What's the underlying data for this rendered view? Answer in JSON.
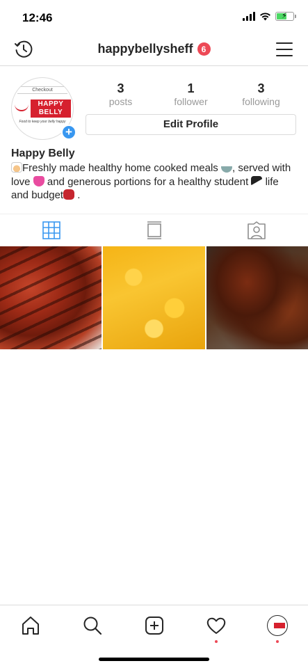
{
  "status_bar": {
    "time": "12:46"
  },
  "top_nav": {
    "username": "happybellysheff",
    "notification_count": "6"
  },
  "profile": {
    "avatar": {
      "checkout_text": "Checkout",
      "logo_text": "HAPPY BELLY",
      "tagline": "Food to keep your belly happy"
    },
    "stats": [
      {
        "count": "3",
        "label": "posts"
      },
      {
        "count": "1",
        "label": "follower"
      },
      {
        "count": "3",
        "label": "following"
      }
    ],
    "edit_button": "Edit Profile",
    "name": "Happy Belly",
    "bio": {
      "part1": "Freshly made healthy home cooked meals",
      "part2": ", served with love",
      "part3": "and generous portions for a healthy student",
      "part4": "life and budget",
      "part5": "."
    }
  },
  "tabs": [
    {
      "icon": "grid-icon",
      "active": true
    },
    {
      "icon": "feed-icon",
      "active": false
    },
    {
      "icon": "tagged-icon",
      "active": false
    }
  ],
  "posts": [
    {
      "subject": "grilled-chicken"
    },
    {
      "subject": "mac-and-cheese"
    },
    {
      "subject": "fried-wings"
    }
  ],
  "bottom_nav": [
    {
      "icon": "home-icon"
    },
    {
      "icon": "search-icon"
    },
    {
      "icon": "add-post-icon"
    },
    {
      "icon": "heart-icon",
      "has_dot": true
    },
    {
      "icon": "profile-avatar",
      "has_dot": true
    }
  ],
  "colors": {
    "accent": "#3897f0",
    "badge": "#ed4956",
    "brand_red": "#d6202e",
    "text": "#262626",
    "muted": "#999999",
    "border": "#dbdbdb"
  }
}
